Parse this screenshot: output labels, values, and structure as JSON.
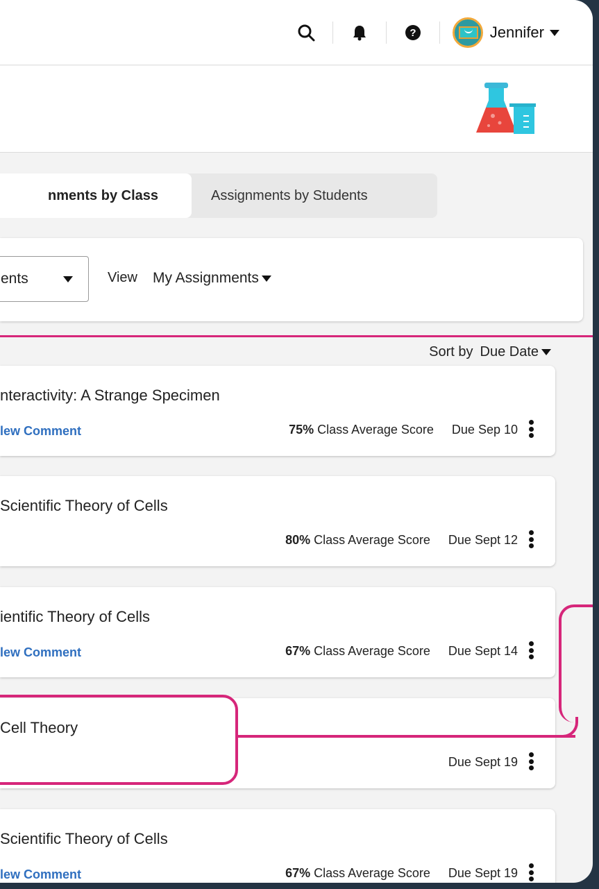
{
  "header": {
    "user_name": "Jennifer",
    "icons": [
      "search-icon",
      "bell-icon",
      "help-icon"
    ]
  },
  "tabs": [
    {
      "label": "nments by Class",
      "active": true
    },
    {
      "label": "Assignments by Students",
      "active": false
    }
  ],
  "filters": {
    "select_value": "ents",
    "view_label": "View",
    "view_value": "My Assignments"
  },
  "sort": {
    "label": "Sort by",
    "value": "Due Date"
  },
  "assignments": [
    {
      "title": "nteractivity: A Strange Specimen",
      "comment": "lew Comment",
      "score": "75%",
      "score_label": "Class Average Score",
      "due": "Due Sep 10"
    },
    {
      "title": " Scientific Theory of Cells",
      "comment": "",
      "score": "80%",
      "score_label": "Class Average Score",
      "due": "Due Sept 12"
    },
    {
      "title": "ientific Theory of Cells",
      "comment": "lew Comment",
      "score": "67%",
      "score_label": "Class Average Score",
      "due": "Due Sept 14"
    },
    {
      "title": "Cell Theory",
      "comment": "",
      "score": "",
      "score_label": "",
      "due": "Due Sept 19"
    },
    {
      "title": "Scientific Theory of Cells",
      "comment": "lew Comment",
      "score": "67%",
      "score_label": "Class Average Score",
      "due": "Due Sept 19"
    }
  ],
  "colors": {
    "accent": "#d6267a",
    "link": "#2f6fbf",
    "frame": "#243444"
  }
}
